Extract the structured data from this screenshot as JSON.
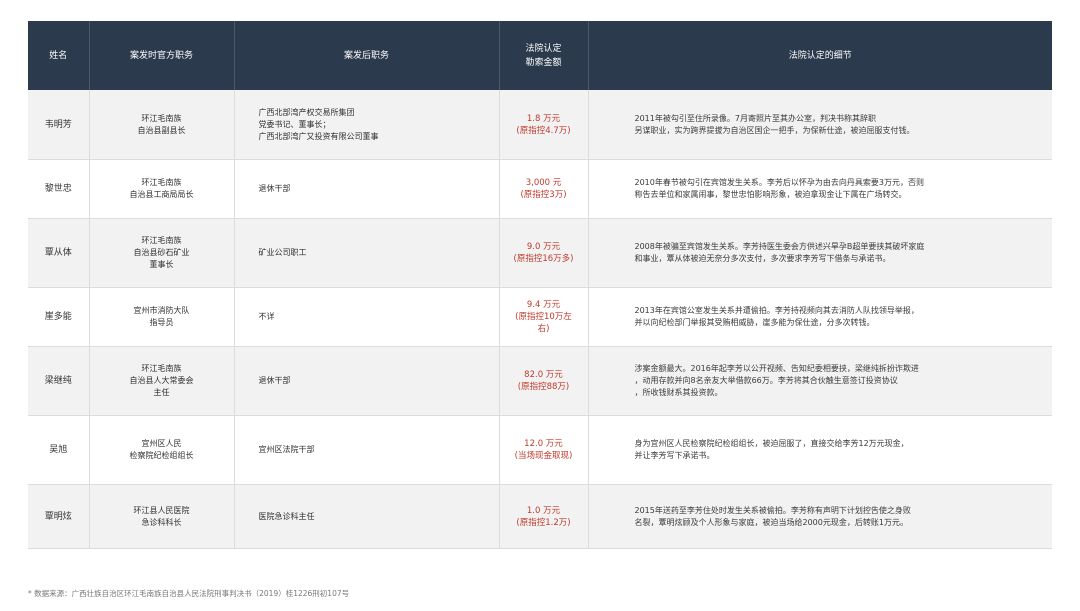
{
  "headers": {
    "name": "姓名",
    "official_position": "案发时官方职务",
    "post_position": "案发后职务",
    "amount": "法院认定\n勒索金额",
    "details": "法院认定的细节"
  },
  "rows": [
    {
      "name": "韦明芳",
      "official_position": "环江毛南族\n自治县副县长",
      "post_position": "广西北部湾产权交易所集团\n党委书记、董事长；\n广西北部湾广又投资有限公司董事",
      "amount": "1.8 万元\n(原指控4.7万)",
      "details": "2011年被勾引至住所录像。7月寄照片至其办公室，判决书称其辞职\n另谋职业，实为跨界提拔为自治区国企一把手，为保新仕途，被迫屈服支付钱。"
    },
    {
      "name": "黎世忠",
      "official_position": "环江毛南族\n自治县工商局局长",
      "post_position": "退休干部",
      "amount": "3,000 元\n(原指控3万)",
      "details": "2010年春节被勾引在宾馆发生关系。李芳后以怀孕为由去向丹具索要3万元，否则\n称告去单位和家属闹事，黎世忠怕影响形象，被迫拿现金让下属在广场转交。"
    },
    {
      "name": "覃从体",
      "official_position": "环江毛南族\n自治县砂石矿业\n董事长",
      "post_position": "矿业公司职工",
      "amount": "9.0 万元\n(原指控16万多)",
      "details": "2008年被骗至宾馆发生关系。李芳持医生委会方供述兴旱孕B超单要挟其破坏家庭\n和事业，覃从体被迫无奈分多次支付，多次要求李芳写下借条与承诺书。"
    },
    {
      "name": "崖多能",
      "official_position": "宜州市消防大队\n指导员",
      "post_position": "不详",
      "amount": "9.4 万元\n(原指控10万左右)",
      "details": "2013年在宾馆公室发生关系并遭偷拍。李芳持视频向其去消防人队找领导举报，\n并以向纪检部门举报其受贿相威胁，崖多能为保仕途，分多次转钱。"
    },
    {
      "name": "梁继纯",
      "official_position": "环江毛南族\n自治县人大常委会\n主任",
      "post_position": "退休干部",
      "amount": "82.0 万元\n(原指控88万)",
      "details": "涉案金额最大。2016年起李芳以公开视频、告知纪委相要挟，梁继纯拆扮诈欺进\n，动用存款并向8名亲友大举借款66万。李芳将其合伙触生意签订投资协议\n，所收钱财系其投资款。"
    },
    {
      "name": "吴旭",
      "official_position": "宜州区人民\n检察院纪检组组长",
      "post_position": "宜州区法院干部",
      "amount": "12.0 万元\n(当场现金取现)",
      "details": "身为宜州区人民检察院纪检组组长，被迫屈服了，直接交给李芳12万元现金，\n并让李芳写下承诺书。"
    },
    {
      "name": "覃明炫",
      "official_position": "环江县人民医院\n急诊科科长",
      "post_position": "医院急诊科主任",
      "amount": "1.0 万元\n(原指控1.2万)",
      "details": "2015年送药至李芳住处时发生关系被偷拍。李芳称有声明下计划控告使之身败\n名裂，覃明炫顾及个人形象与家庭，被迫当场给2000元现金，后转账1万元。"
    }
  ],
  "source_note": "* 数据来源：广西壮族自治区环江毛南族自治县人民法院刑事判决书（2019）桂1226刑初107号"
}
